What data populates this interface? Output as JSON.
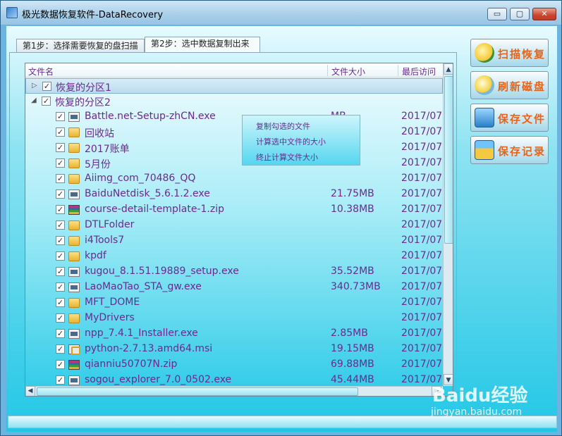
{
  "window": {
    "title": "极光数据恢复软件-DataRecovery",
    "min_glyph": "▭",
    "max_glyph": "▢",
    "close_glyph": "✕"
  },
  "tabs": [
    {
      "label": "第1步：选择需要恢复的盘扫描",
      "active": false
    },
    {
      "label": "第2步：选中数据复制出来",
      "active": true
    }
  ],
  "file_list": {
    "columns": [
      "文件名",
      "文件大小",
      "最后访问时"
    ],
    "partitions": [
      {
        "label": "恢复的分区1",
        "expanded": false,
        "selected": true
      },
      {
        "label": "恢复的分区2",
        "expanded": true,
        "selected": false
      }
    ],
    "files": [
      {
        "icon": "exe-icon",
        "name": "Battle.net-Setup-zhCN.exe",
        "size": "MB",
        "date": "2017/07"
      },
      {
        "icon": "folder-icon",
        "name": "回收站",
        "size": "",
        "date": "2017/07"
      },
      {
        "icon": "folder-icon",
        "name": "2017账单",
        "size": "",
        "date": "2017/07"
      },
      {
        "icon": "folder-icon",
        "name": "5月份",
        "size": "",
        "date": "2017/07"
      },
      {
        "icon": "folder-icon",
        "name": "Aiimg_com_70486_QQ",
        "size": "",
        "date": "2017/07"
      },
      {
        "icon": "exe-icon",
        "name": "BaiduNetdisk_5.6.1.2.exe",
        "size": "21.75MB",
        "date": "2017/07"
      },
      {
        "icon": "zip-icon",
        "name": "course-detail-template-1.zip",
        "size": "10.38MB",
        "date": "2017/07"
      },
      {
        "icon": "folder-icon",
        "name": "DTLFolder",
        "size": "",
        "date": "2017/07"
      },
      {
        "icon": "folder-icon",
        "name": "i4Tools7",
        "size": "",
        "date": "2017/07"
      },
      {
        "icon": "folder-icon",
        "name": "kpdf",
        "size": "",
        "date": "2017/07"
      },
      {
        "icon": "exe-icon",
        "name": "kugou_8.1.51.19889_setup.exe",
        "size": "35.52MB",
        "date": "2017/07"
      },
      {
        "icon": "exe-icon",
        "name": "LaoMaoTao_STA_gw.exe",
        "size": "340.73MB",
        "date": "2017/07"
      },
      {
        "icon": "folder-icon",
        "name": "MFT_DOME",
        "size": "",
        "date": "2017/07"
      },
      {
        "icon": "folder-icon",
        "name": "MyDrivers",
        "size": "",
        "date": "2017/07"
      },
      {
        "icon": "exe-icon",
        "name": "npp_7.4.1_Installer.exe",
        "size": "2.85MB",
        "date": "2017/07"
      },
      {
        "icon": "msi-icon",
        "name": "python-2.7.13.amd64.msi",
        "size": "19.15MB",
        "date": "2017/07"
      },
      {
        "icon": "zip-icon",
        "name": "qianniu50707N.zip",
        "size": "69.88MB",
        "date": "2017/07"
      },
      {
        "icon": "exe-icon",
        "name": "sogou_explorer_7.0_0502.exe",
        "size": "45.44MB",
        "date": "2017/07"
      }
    ]
  },
  "context_menu": {
    "items": [
      "复制勾选的文件",
      "计算选中文件的大小",
      "终止计算文件大小"
    ]
  },
  "side_buttons": [
    {
      "label": "扫描恢复",
      "icon": "magnifier-icon"
    },
    {
      "label": "刷新磁盘",
      "icon": "refresh-disk-icon"
    },
    {
      "label": "保存文件",
      "icon": "save-file-icon"
    },
    {
      "label": "保存记录",
      "icon": "save-record-icon"
    }
  ],
  "watermark": {
    "logo": "Baidu经验",
    "url": "jingyan.baidu.com"
  },
  "colors": {
    "accent": "#e8641a",
    "text_purple": "#6b2a8e",
    "client_bg": "#22c7e6"
  }
}
